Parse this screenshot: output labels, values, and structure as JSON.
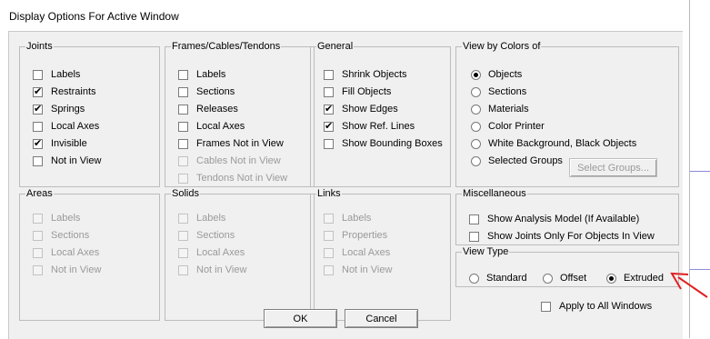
{
  "window": {
    "title": "Display Options For Active Window"
  },
  "joints": {
    "title": "Joints",
    "items": [
      {
        "label": "Labels",
        "checked": false,
        "enabled": true
      },
      {
        "label": "Restraints",
        "checked": true,
        "enabled": true
      },
      {
        "label": "Springs",
        "checked": true,
        "enabled": true
      },
      {
        "label": "Local Axes",
        "checked": false,
        "enabled": true
      },
      {
        "label": "Invisible",
        "checked": true,
        "enabled": true
      },
      {
        "label": "Not in View",
        "checked": false,
        "enabled": true
      }
    ]
  },
  "frames": {
    "title": "Frames/Cables/Tendons",
    "items": [
      {
        "label": "Labels",
        "checked": false,
        "enabled": true
      },
      {
        "label": "Sections",
        "checked": false,
        "enabled": true
      },
      {
        "label": "Releases",
        "checked": false,
        "enabled": true
      },
      {
        "label": "Local Axes",
        "checked": false,
        "enabled": true
      },
      {
        "label": "Frames Not in View",
        "checked": false,
        "enabled": true
      },
      {
        "label": "Cables Not in View",
        "checked": false,
        "enabled": false
      },
      {
        "label": "Tendons Not in View",
        "checked": false,
        "enabled": false
      }
    ]
  },
  "general": {
    "title": "General",
    "items": [
      {
        "label": "Shrink Objects",
        "checked": false,
        "enabled": true
      },
      {
        "label": "Fill Objects",
        "checked": false,
        "enabled": true
      },
      {
        "label": "Show Edges",
        "checked": true,
        "enabled": true
      },
      {
        "label": "Show Ref. Lines",
        "checked": true,
        "enabled": true
      },
      {
        "label": "Show Bounding Boxes",
        "checked": false,
        "enabled": true
      }
    ]
  },
  "view_by_colors": {
    "title": "View by Colors of",
    "items": [
      {
        "label": "Objects",
        "selected": true
      },
      {
        "label": "Sections",
        "selected": false
      },
      {
        "label": "Materials",
        "selected": false
      },
      {
        "label": "Color Printer",
        "selected": false
      },
      {
        "label": "White Background, Black Objects",
        "selected": false
      },
      {
        "label": "Selected Groups",
        "selected": false
      }
    ],
    "select_groups_button": "Select Groups..."
  },
  "areas": {
    "title": "Areas",
    "items": [
      {
        "label": "Labels",
        "checked": false,
        "enabled": false
      },
      {
        "label": "Sections",
        "checked": false,
        "enabled": false
      },
      {
        "label": "Local Axes",
        "checked": false,
        "enabled": false
      },
      {
        "label": "Not in View",
        "checked": false,
        "enabled": false
      }
    ]
  },
  "solids": {
    "title": "Solids",
    "items": [
      {
        "label": "Labels",
        "checked": false,
        "enabled": false
      },
      {
        "label": "Sections",
        "checked": false,
        "enabled": false
      },
      {
        "label": "Local Axes",
        "checked": false,
        "enabled": false
      },
      {
        "label": "Not in View",
        "checked": false,
        "enabled": false
      }
    ]
  },
  "links": {
    "title": "Links",
    "items": [
      {
        "label": "Labels",
        "checked": false,
        "enabled": false
      },
      {
        "label": "Properties",
        "checked": false,
        "enabled": false
      },
      {
        "label": "Local Axes",
        "checked": false,
        "enabled": false
      },
      {
        "label": "Not in View",
        "checked": false,
        "enabled": false
      }
    ]
  },
  "miscellaneous": {
    "title": "Miscellaneous",
    "items": [
      {
        "label": "Show Analysis Model  (If Available)",
        "checked": false,
        "enabled": true
      },
      {
        "label": "Show Joints Only For Objects In View",
        "checked": false,
        "enabled": true
      }
    ]
  },
  "view_type": {
    "title": "View Type",
    "items": [
      {
        "label": "Standard",
        "selected": false
      },
      {
        "label": "Offset",
        "selected": false
      },
      {
        "label": "Extruded",
        "selected": true
      }
    ]
  },
  "apply_all": {
    "label": "Apply to All Windows",
    "checked": false
  },
  "buttons": {
    "ok": "OK",
    "cancel": "Cancel"
  },
  "colors": {
    "annotation_arrow": "#e02020",
    "background_lines": "#8a8ae0"
  }
}
